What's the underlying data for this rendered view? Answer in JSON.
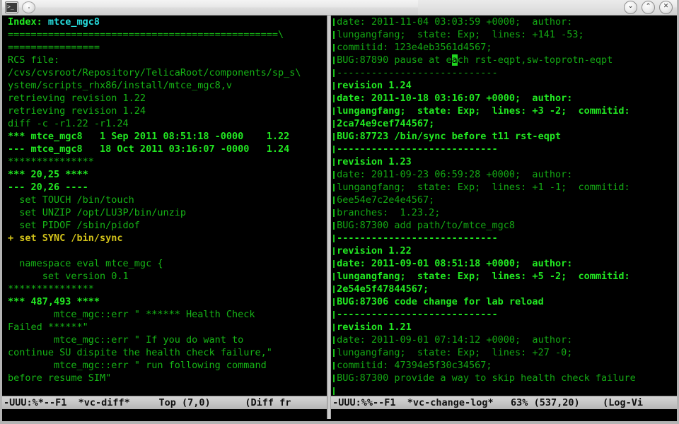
{
  "window": {
    "titlebar": {
      "app_icon": "terminal-icon",
      "round_button": "circle-button",
      "controls": [
        {
          "name": "minimize-button",
          "glyph": "⌄"
        },
        {
          "name": "maximize-button",
          "glyph": "⌃"
        },
        {
          "name": "close-button",
          "glyph": "✕"
        }
      ]
    }
  },
  "colors": {
    "background": "#000000",
    "green": "#16b516",
    "green_bold": "#22e822",
    "green_dim": "#14a814",
    "cyan": "#27dede",
    "gold": "#d2c21a",
    "cursor": "#1fd81f",
    "modeline_bg": "#c6c6c6",
    "modeline_fg": "#101010",
    "frame": "#b4b4b4"
  },
  "left_pane": {
    "buffer_name": "*vc-diff*",
    "lines": [
      {
        "segments": [
          {
            "text": "Index: ",
            "style": "bold"
          },
          {
            "text": "mtce_mgc8",
            "style": "cyan"
          }
        ]
      },
      {
        "segments": [
          {
            "text": "===============================================\\",
            "style": "plain"
          }
        ]
      },
      {
        "segments": [
          {
            "text": "================",
            "style": "plain"
          }
        ]
      },
      {
        "segments": [
          {
            "text": "RCS file:",
            "style": "plain"
          }
        ]
      },
      {
        "segments": [
          {
            "text": "/cvs/cvsroot/Repository/TelicaRoot/components/sp_s\\",
            "style": "plain"
          }
        ]
      },
      {
        "segments": [
          {
            "text": "ystem/scripts_rhx86/install/mtce_mgc8,v",
            "style": "plain"
          }
        ]
      },
      {
        "segments": [
          {
            "text": "retrieving revision 1.22",
            "style": "plain"
          }
        ]
      },
      {
        "segments": [
          {
            "text": "retrieving revision 1.24",
            "style": "plain"
          }
        ]
      },
      {
        "segments": [
          {
            "text": "diff -c -r1.22 -r1.24",
            "style": "plain"
          }
        ]
      },
      {
        "segments": [
          {
            "text": "*** mtce_mgc8   1 Sep 2011 08:51:18 -0000    1.22",
            "style": "bold"
          }
        ]
      },
      {
        "segments": [
          {
            "text": "--- mtce_mgc8   18 Oct 2011 03:16:07 -0000   1.24",
            "style": "bold"
          }
        ]
      },
      {
        "segments": [
          {
            "text": "***************",
            "style": "plain"
          }
        ]
      },
      {
        "segments": [
          {
            "text": "*** 20,25 ****",
            "style": "bold"
          }
        ]
      },
      {
        "segments": [
          {
            "text": "--- 20,26 ----",
            "style": "bold"
          }
        ]
      },
      {
        "segments": [
          {
            "text": "  set TOUCH /bin/touch",
            "style": "plain"
          }
        ]
      },
      {
        "segments": [
          {
            "text": "  set UNZIP /opt/LU3P/bin/unzip",
            "style": "plain"
          }
        ]
      },
      {
        "segments": [
          {
            "text": "  set PIDOF /sbin/pidof",
            "style": "plain"
          }
        ]
      },
      {
        "segments": [
          {
            "text": "+ set SYNC /bin/sync",
            "style": "gold"
          }
        ]
      },
      {
        "segments": [
          {
            "text": "",
            "style": "plain"
          }
        ]
      },
      {
        "segments": [
          {
            "text": "  namespace eval mtce_mgc {",
            "style": "plain"
          }
        ]
      },
      {
        "segments": [
          {
            "text": "      set version 0.1",
            "style": "plain"
          }
        ]
      },
      {
        "segments": [
          {
            "text": "***************",
            "style": "plain"
          }
        ]
      },
      {
        "segments": [
          {
            "text": "*** 487,493 ****",
            "style": "bold"
          }
        ]
      },
      {
        "segments": [
          {
            "text": "        mtce_mgc::err \" ****** Health Check",
            "style": "plain"
          }
        ]
      },
      {
        "segments": [
          {
            "text": "Failed ******\"",
            "style": "plain"
          }
        ]
      },
      {
        "segments": [
          {
            "text": "        mtce_mgc::err \" If you do want to",
            "style": "plain"
          }
        ]
      },
      {
        "segments": [
          {
            "text": "continue SU dispite the health check failure,\"",
            "style": "plain"
          }
        ]
      },
      {
        "segments": [
          {
            "text": "        mtce_mgc::err \" run following command",
            "style": "plain"
          }
        ]
      },
      {
        "segments": [
          {
            "text": "before resume SIM\"",
            "style": "plain"
          }
        ]
      }
    ],
    "mode_line": {
      "status": "-UUU:%*--F1",
      "buffer": "*vc-diff*",
      "position": "Top (7,0)",
      "mode": "(Diff fr",
      "full": "-UUU:%*--F1  *vc-diff*     Top (7,0)      (Diff fr"
    }
  },
  "right_pane": {
    "buffer_name": "*vc-change-log*",
    "lines": [
      {
        "segments": [
          {
            "text": "date: 2011-11-04 03:03:59 +0000;  author:",
            "style": "dim"
          }
        ]
      },
      {
        "segments": [
          {
            "text": "lungangfang;  state: Exp;  lines: +141 -53;",
            "style": "dim"
          }
        ]
      },
      {
        "segments": [
          {
            "text": "commitid: 123e4eb3561d4567;",
            "style": "dim"
          }
        ]
      },
      {
        "segments": [
          {
            "text": "BUG:87890 pause at e",
            "style": "dim"
          },
          {
            "text": "a",
            "style": "cursor"
          },
          {
            "text": "ch rst-eqpt,sw-toprotn-eqpt",
            "style": "dim"
          }
        ]
      },
      {
        "segments": [
          {
            "text": "----------------------------",
            "style": "dim"
          }
        ]
      },
      {
        "segments": [
          {
            "text": "revision 1.24",
            "style": "bold"
          }
        ]
      },
      {
        "segments": [
          {
            "text": "date: 2011-10-18 03:16:07 +0000;  author:",
            "style": "bold"
          }
        ]
      },
      {
        "segments": [
          {
            "text": "lungangfang;  state: Exp;  lines: +3 -2;  commitid:",
            "style": "bold"
          }
        ]
      },
      {
        "segments": [
          {
            "text": "2ca74e9cef744567;",
            "style": "bold"
          }
        ]
      },
      {
        "segments": [
          {
            "text": "BUG:87723 /bin/sync before t11 rst-eqpt",
            "style": "bold"
          }
        ]
      },
      {
        "segments": [
          {
            "text": "----------------------------",
            "style": "bold"
          }
        ]
      },
      {
        "segments": [
          {
            "text": "revision 1.23",
            "style": "bold"
          }
        ]
      },
      {
        "segments": [
          {
            "text": "date: 2011-09-23 06:59:28 +0000;  author:",
            "style": "dim"
          }
        ]
      },
      {
        "segments": [
          {
            "text": "lungangfang;  state: Exp;  lines: +1 -1;  commitid:",
            "style": "dim"
          }
        ]
      },
      {
        "segments": [
          {
            "text": "6ee54e7c2e4e4567;",
            "style": "dim"
          }
        ]
      },
      {
        "segments": [
          {
            "text": "branches:  1.23.2;",
            "style": "dim"
          }
        ]
      },
      {
        "segments": [
          {
            "text": "BUG:87300 add path/to/mtce_mgc8",
            "style": "dim"
          }
        ]
      },
      {
        "segments": [
          {
            "text": "----------------------------",
            "style": "bold"
          }
        ]
      },
      {
        "segments": [
          {
            "text": "revision 1.22",
            "style": "bold"
          }
        ]
      },
      {
        "segments": [
          {
            "text": "date: 2011-09-01 08:51:18 +0000;  author:",
            "style": "bold"
          }
        ]
      },
      {
        "segments": [
          {
            "text": "lungangfang;  state: Exp;  lines: +5 -2;  commitid:",
            "style": "bold"
          }
        ]
      },
      {
        "segments": [
          {
            "text": "2e54e5f47844567;",
            "style": "bold"
          }
        ]
      },
      {
        "segments": [
          {
            "text": "BUG:87306 code change for lab reload",
            "style": "bold"
          }
        ]
      },
      {
        "segments": [
          {
            "text": "----------------------------",
            "style": "bold"
          }
        ]
      },
      {
        "segments": [
          {
            "text": "revision 1.21",
            "style": "bold"
          }
        ]
      },
      {
        "segments": [
          {
            "text": "date: 2011-09-01 07:14:12 +0000;  author:",
            "style": "dim"
          }
        ]
      },
      {
        "segments": [
          {
            "text": "lungangfang;  state: Exp;  lines: +27 -0;",
            "style": "dim"
          }
        ]
      },
      {
        "segments": [
          {
            "text": "commitid: 47394e5f30c34567;",
            "style": "dim"
          }
        ]
      },
      {
        "segments": [
          {
            "text": "BUG:87300 provide a way to skip health check failure",
            "style": "dim"
          }
        ]
      }
    ],
    "mode_line": {
      "status": "-UUU:%%--F1",
      "buffer": "*vc-change-log*",
      "position": "63% (537,20)",
      "mode": "(Log-Vi",
      "full": "-UUU:%%--F1  *vc-change-log*   63% (537,20)    (Log-Vi"
    }
  }
}
